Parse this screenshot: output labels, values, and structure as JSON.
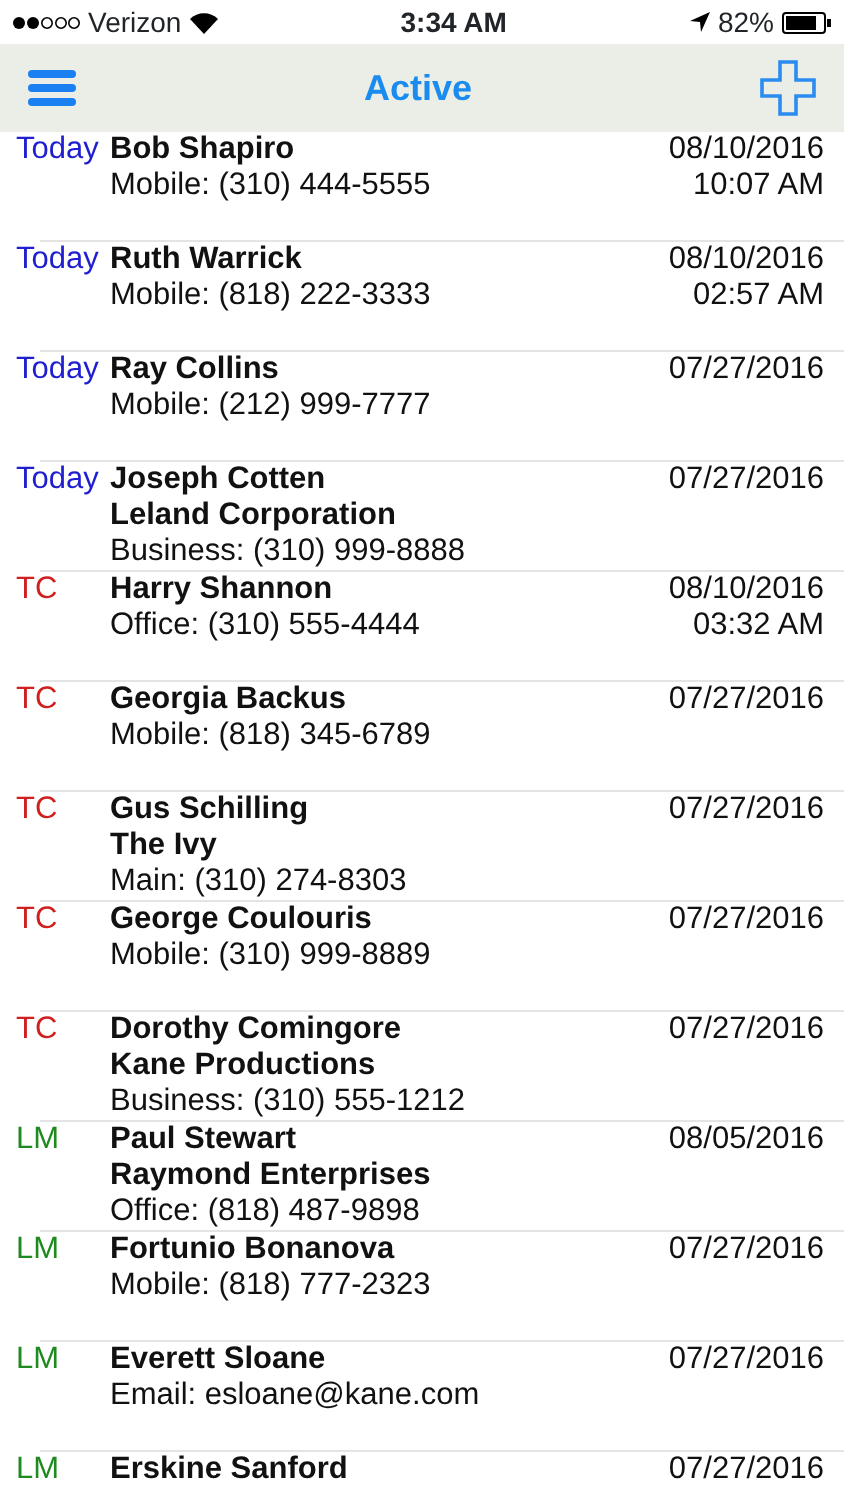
{
  "status_bar": {
    "carrier": "Verizon",
    "time": "3:34 AM",
    "battery": "82%"
  },
  "nav": {
    "title": "Active"
  },
  "rows": [
    {
      "tag": "Today",
      "color": "#1f1fd0",
      "lines": [
        "Bob Shapiro",
        "Mobile: (310) 444-5555"
      ],
      "date": "08/10/2016",
      "time": "10:07 AM"
    },
    {
      "tag": "Today",
      "color": "#1f1fd0",
      "lines": [
        "Ruth Warrick",
        "Mobile: (818) 222-3333"
      ],
      "date": "08/10/2016",
      "time": "02:57 AM"
    },
    {
      "tag": "Today",
      "color": "#1f1fd0",
      "lines": [
        "Ray Collins",
        "Mobile: (212) 999-7777"
      ],
      "date": "07/27/2016"
    },
    {
      "tag": "Today",
      "color": "#1f1fd0",
      "lines": [
        "Joseph Cotten",
        "Leland Corporation",
        "Business: (310) 999-8888"
      ],
      "date": "07/27/2016"
    },
    {
      "tag": "TC",
      "color": "#d01f1f",
      "lines": [
        "Harry Shannon",
        "Office: (310) 555-4444"
      ],
      "date": "08/10/2016",
      "time": "03:32 AM"
    },
    {
      "tag": "TC",
      "color": "#d01f1f",
      "lines": [
        "Georgia Backus",
        "Mobile: (818) 345-6789"
      ],
      "date": "07/27/2016"
    },
    {
      "tag": "TC",
      "color": "#d01f1f",
      "lines": [
        "Gus Schilling",
        "The Ivy",
        "Main: (310) 274-8303"
      ],
      "date": "07/27/2016"
    },
    {
      "tag": "TC",
      "color": "#d01f1f",
      "lines": [
        "George Coulouris",
        "Mobile: (310) 999-8889"
      ],
      "date": "07/27/2016"
    },
    {
      "tag": "TC",
      "color": "#d01f1f",
      "lines": [
        "Dorothy Comingore",
        "Kane Productions",
        "Business: (310) 555-1212"
      ],
      "date": "07/27/2016"
    },
    {
      "tag": "LM",
      "color": "#1f8a1f",
      "lines": [
        "Paul Stewart",
        "Raymond Enterprises",
        "Office: (818) 487-9898"
      ],
      "date": "08/05/2016"
    },
    {
      "tag": "LM",
      "color": "#1f8a1f",
      "lines": [
        "Fortunio Bonanova",
        "Mobile: (818) 777-2323"
      ],
      "date": "07/27/2016"
    },
    {
      "tag": "LM",
      "color": "#1f8a1f",
      "lines": [
        "Everett Sloane",
        "Email: esloane@kane.com"
      ],
      "date": "07/27/2016"
    },
    {
      "tag": "LM",
      "color": "#1f8a1f",
      "lines": [
        "Erskine Sanford"
      ],
      "date": "07/27/2016"
    }
  ]
}
